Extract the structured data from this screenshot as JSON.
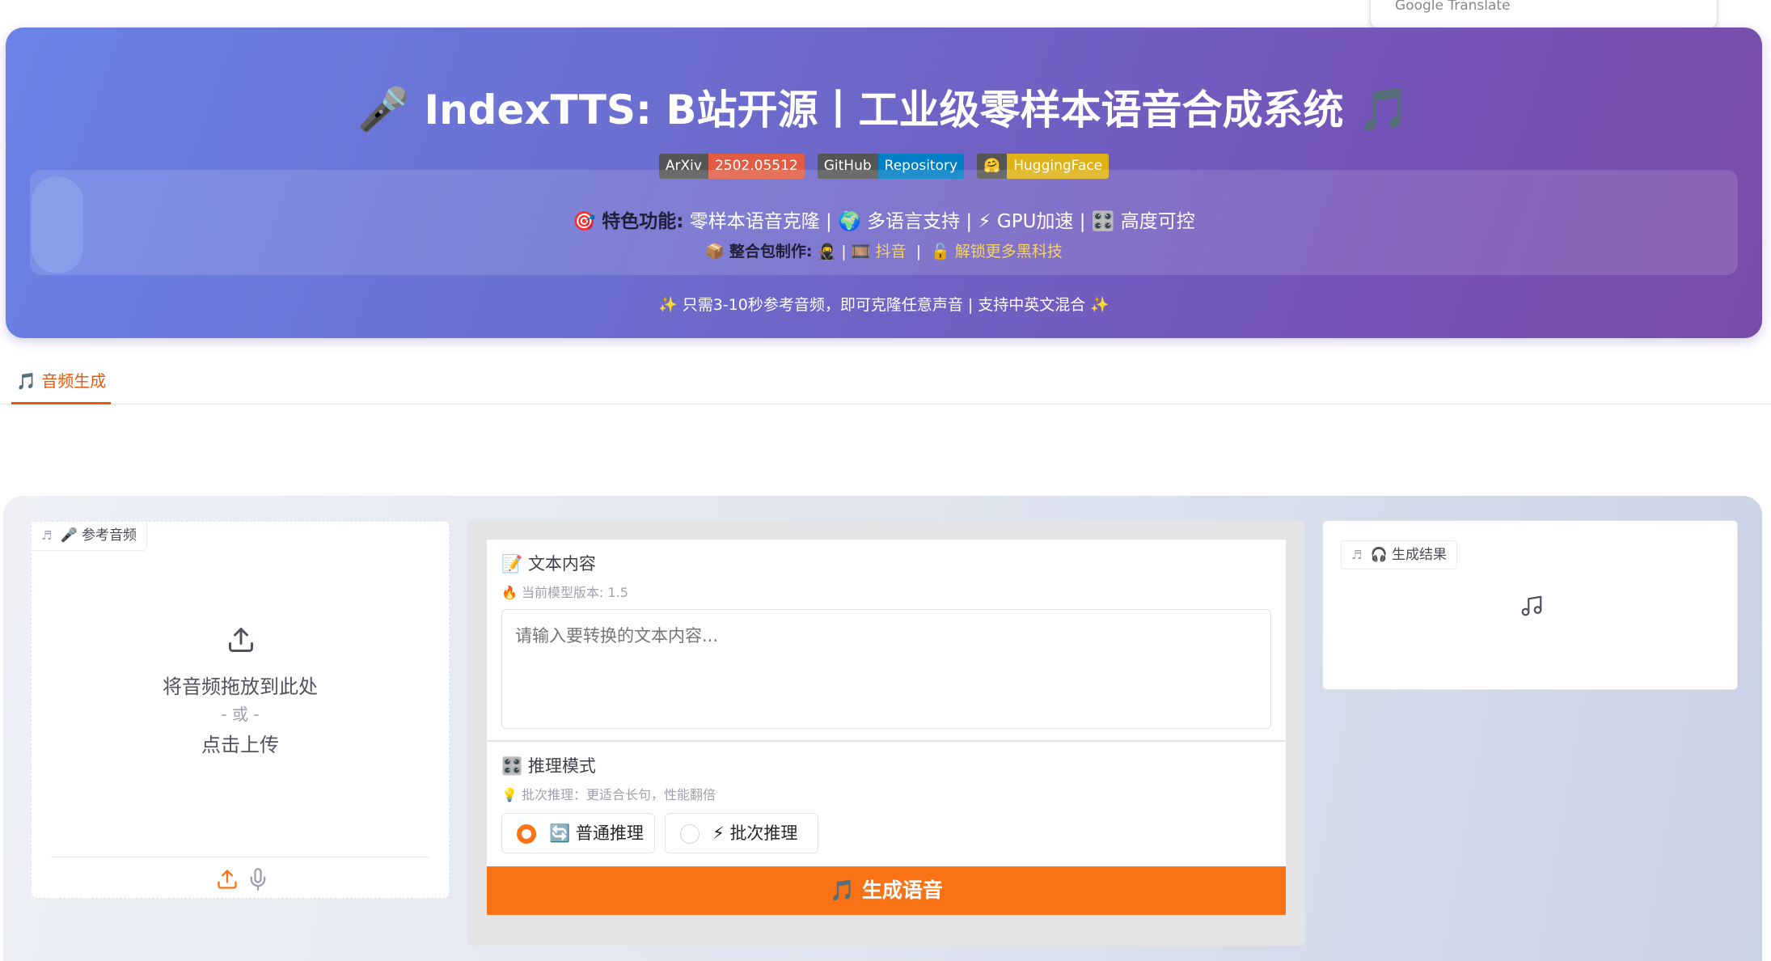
{
  "overlay": {
    "text": "Google Translate"
  },
  "header": {
    "title_emoji_left": "🎤",
    "title": "IndexTTS: B站开源丨工业级零样本语音合成系统",
    "title_emoji_right": "🎵",
    "badges": [
      {
        "left": "ArXiv",
        "right": "2502.05512",
        "color": "#e05d44"
      },
      {
        "left": "GitHub",
        "right": "Repository",
        "color": "#007ec6"
      },
      {
        "left": "🤗",
        "right": "HuggingFace",
        "color": "#dfb317"
      }
    ],
    "features": {
      "icon": "🎯",
      "label": "特色功能",
      "items": "零样本语音克隆 | 🌍 多语言支持 | ⚡ GPU加速 | 🎛️ 高度可控"
    },
    "credits": {
      "icon": "📦",
      "label": "整合包制作",
      "items_prefix": "🥷",
      "items_mid": "| 🎞️",
      "douyin": "抖音",
      "sep": "|",
      "unlock_icon": "🔓",
      "unlock": "解锁更多黑科技"
    },
    "tagline": "✨ 只需3-10秒参考音频，即可克隆任意声音 | 支持中英文混合 ✨"
  },
  "tabs": [
    {
      "icon": "🎵",
      "label": "音频生成",
      "active": true
    }
  ],
  "reference_audio": {
    "label_icon": "🎤",
    "label": "参考音频",
    "drop_text": "将音频拖放到此处",
    "or_text": "- 或 -",
    "click_text": "点击上传"
  },
  "text_content": {
    "title_icon": "📝",
    "title": "文本内容",
    "model_icon": "🔥",
    "model_version": "当前模型版本: 1.5",
    "placeholder": "请输入要转换的文本内容..."
  },
  "inference": {
    "title_icon": "🎛️",
    "title": "推理模式",
    "hint_icon": "💡",
    "hint": "批次推理：更适合长句，性能翻倍",
    "options": [
      {
        "icon": "🔄",
        "label": "普通推理",
        "selected": true
      },
      {
        "icon": "⚡",
        "label": "批次推理",
        "selected": false
      }
    ]
  },
  "generate_button": {
    "icon": "🎵",
    "label": "生成语音"
  },
  "result": {
    "label_icon": "🎧",
    "label": "生成结果"
  },
  "colors": {
    "accent": "#f97316",
    "hero_start": "#6a82e6",
    "hero_end": "#7a4ca9"
  }
}
